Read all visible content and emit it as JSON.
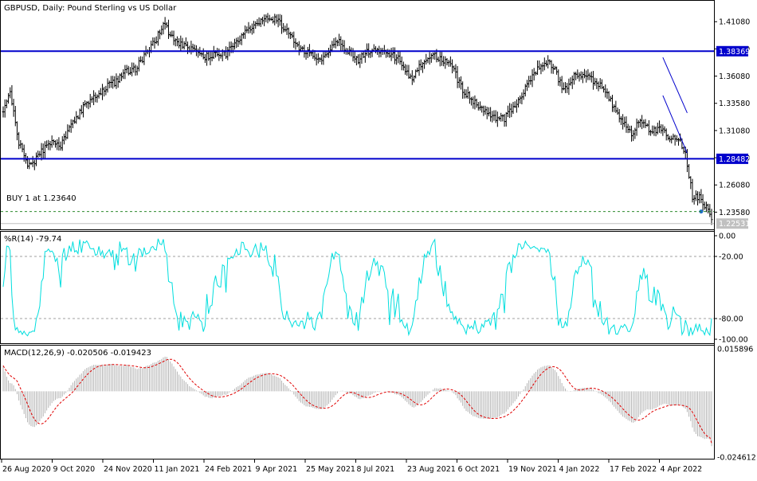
{
  "chart_data": [
    {
      "type": "ohlc",
      "title": "GBPUSD, Daily:  Pound Sterling vs US Dollar",
      "ylim": [
        1.22,
        1.43
      ],
      "price_ticks": [
        "1.41080",
        "1.38580",
        "1.36080",
        "1.33580",
        "1.31080",
        "1.28580",
        "1.26080",
        "1.23580"
      ],
      "price_tick_values": [
        1.4108,
        1.3858,
        1.3608,
        1.3358,
        1.3108,
        1.2858,
        1.2608,
        1.2358
      ],
      "resistance": {
        "value": 1.38369,
        "label": "1.38369",
        "color": "#0000cc"
      },
      "support": {
        "value": 1.28482,
        "label": "1.28482",
        "color": "#0000cc"
      },
      "order_line": {
        "value": 1.2364,
        "label": "BUY 1 at 1.23640",
        "color": "#2e8b2e"
      },
      "current_price": {
        "value": 1.22531,
        "label": "1.22531"
      },
      "bar_color": "#000000",
      "anchors": [
        [
          0,
          1.33
        ],
        [
          4,
          1.345
        ],
        [
          9,
          1.3
        ],
        [
          14,
          1.278
        ],
        [
          18,
          1.282
        ],
        [
          22,
          1.292
        ],
        [
          28,
          1.3
        ],
        [
          33,
          1.296
        ],
        [
          38,
          1.312
        ],
        [
          45,
          1.33
        ],
        [
          52,
          1.342
        ],
        [
          58,
          1.35
        ],
        [
          64,
          1.355
        ],
        [
          70,
          1.365
        ],
        [
          76,
          1.367
        ],
        [
          82,
          1.382
        ],
        [
          88,
          1.395
        ],
        [
          92,
          1.41
        ],
        [
          96,
          1.398
        ],
        [
          102,
          1.39
        ],
        [
          108,
          1.386
        ],
        [
          115,
          1.378
        ],
        [
          122,
          1.382
        ],
        [
          128,
          1.381
        ],
        [
          134,
          1.392
        ],
        [
          140,
          1.402
        ],
        [
          146,
          1.41
        ],
        [
          152,
          1.415
        ],
        [
          158,
          1.411
        ],
        [
          164,
          1.4
        ],
        [
          170,
          1.385
        ],
        [
          176,
          1.382
        ],
        [
          182,
          1.376
        ],
        [
          188,
          1.386
        ],
        [
          193,
          1.393
        ],
        [
          198,
          1.383
        ],
        [
          204,
          1.376
        ],
        [
          210,
          1.384
        ],
        [
          216,
          1.383
        ],
        [
          222,
          1.381
        ],
        [
          228,
          1.376
        ],
        [
          234,
          1.358
        ],
        [
          240,
          1.372
        ],
        [
          246,
          1.382
        ],
        [
          252,
          1.376
        ],
        [
          258,
          1.369
        ],
        [
          264,
          1.347
        ],
        [
          270,
          1.338
        ],
        [
          276,
          1.33
        ],
        [
          282,
          1.322
        ],
        [
          288,
          1.322
        ],
        [
          294,
          1.334
        ],
        [
          300,
          1.35
        ],
        [
          306,
          1.366
        ],
        [
          312,
          1.374
        ],
        [
          316,
          1.37
        ],
        [
          322,
          1.347
        ],
        [
          328,
          1.36
        ],
        [
          334,
          1.362
        ],
        [
          340,
          1.356
        ],
        [
          346,
          1.348
        ],
        [
          351,
          1.332
        ],
        [
          356,
          1.318
        ],
        [
          361,
          1.308
        ],
        [
          366,
          1.32
        ],
        [
          372,
          1.31
        ],
        [
          378,
          1.312
        ],
        [
          384,
          1.302
        ],
        [
          388,
          1.305
        ],
        [
          392,
          1.29
        ],
        [
          396,
          1.25
        ],
        [
          400,
          1.25
        ],
        [
          404,
          1.24
        ],
        [
          407,
          1.228
        ]
      ]
    },
    {
      "type": "line",
      "title": "%R(14) -79.74",
      "ylim": [
        -100,
        0
      ],
      "ticks": [
        "0.00",
        "-20.00",
        "-80.00",
        "-100.00"
      ],
      "tick_values": [
        0,
        -20,
        -80,
        -100
      ],
      "levels": [
        -20,
        -80
      ],
      "line_color": "#00dede",
      "last_value": -79.74
    },
    {
      "type": "bar+line",
      "title": "MACD(12,26,9) -0.020506 -0.019423",
      "ylim": [
        -0.024612,
        0.015896
      ],
      "ticks": [
        "0.015896",
        "-0.024612"
      ],
      "tick_values": [
        0.015896,
        -0.024612
      ],
      "macd_last": -0.020506,
      "signal_last": -0.019423,
      "histogram_color": "#b4b4b4",
      "signal_color": "#e00000"
    }
  ],
  "x_axis": {
    "labels": [
      "26 Aug 2020",
      "9 Oct 2020",
      "24 Nov 2020",
      "11 Jan 2021",
      "24 Feb 2021",
      "9 Apr 2021",
      "25 May 2021",
      "8 Jul 2021",
      "23 Aug 2021",
      "6 Oct 2021",
      "19 Nov 2021",
      "4 Jan 2022",
      "17 Feb 2022",
      "4 Apr 2022"
    ]
  }
}
